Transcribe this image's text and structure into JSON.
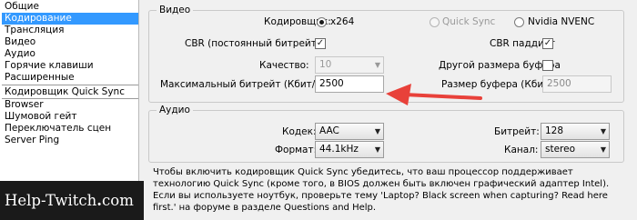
{
  "sidebar": {
    "items": [
      {
        "label": "Общие"
      },
      {
        "label": "Кодирование",
        "selected": true
      },
      {
        "label": "Трансляция"
      },
      {
        "label": "Видео"
      },
      {
        "label": "Аудио"
      },
      {
        "label": "Горячие клавиши"
      },
      {
        "label": "Расширенные"
      },
      {
        "label": "Кодировщик Quick Sync"
      },
      {
        "label": "Browser"
      },
      {
        "label": "Шумовой гейт"
      },
      {
        "label": "Переключатель сцен"
      },
      {
        "label": "Server Ping"
      }
    ]
  },
  "video": {
    "group_label": "Видео",
    "encoder_label": "Кодировщик:",
    "encoder_options": [
      "x264",
      "Quick Sync",
      "Nvidia NVENC"
    ],
    "encoder_selected": "x264",
    "cbr_label": "CBR (постоянный битрейт)",
    "cbr_checked": true,
    "cbr_padding_label": "CBR паддинг",
    "cbr_padding_checked": true,
    "quality_label": "Качество:",
    "quality_value": "10",
    "other_buffer_label": "Другой размера буфера",
    "other_buffer_checked": false,
    "max_bitrate_label": "Максимальный битрейт (Кбит/с):",
    "max_bitrate_value": "2500",
    "buffer_size_label": "Размер буфера (Кбит):",
    "buffer_size_value": "2500"
  },
  "audio": {
    "group_label": "Аудио",
    "codec_label": "Кодек:",
    "codec_value": "AAC",
    "bitrate_label": "Битрейт:",
    "bitrate_value": "128",
    "format_label": "Формат:",
    "format_value": "44.1kHz",
    "channel_label": "Канал:",
    "channel_value": "stereo"
  },
  "info_text": "Чтобы включить кодировщик Quick Sync убедитесь, что ваш процессор поддерживает технологию Quick Sync (кроме того, в BIOS должен быть включен графический адаптер Intel). Если вы используете ноутбук, проверьте тему 'Laptop? Black screen when capturing? Read here first.' на форуме в разделе Questions and Help.",
  "watermark": {
    "prefix": "Help-Twitch",
    "dot": ".",
    "suffix": "com"
  },
  "colors": {
    "selection": "#3399ff",
    "arrow": "#e8413a"
  }
}
